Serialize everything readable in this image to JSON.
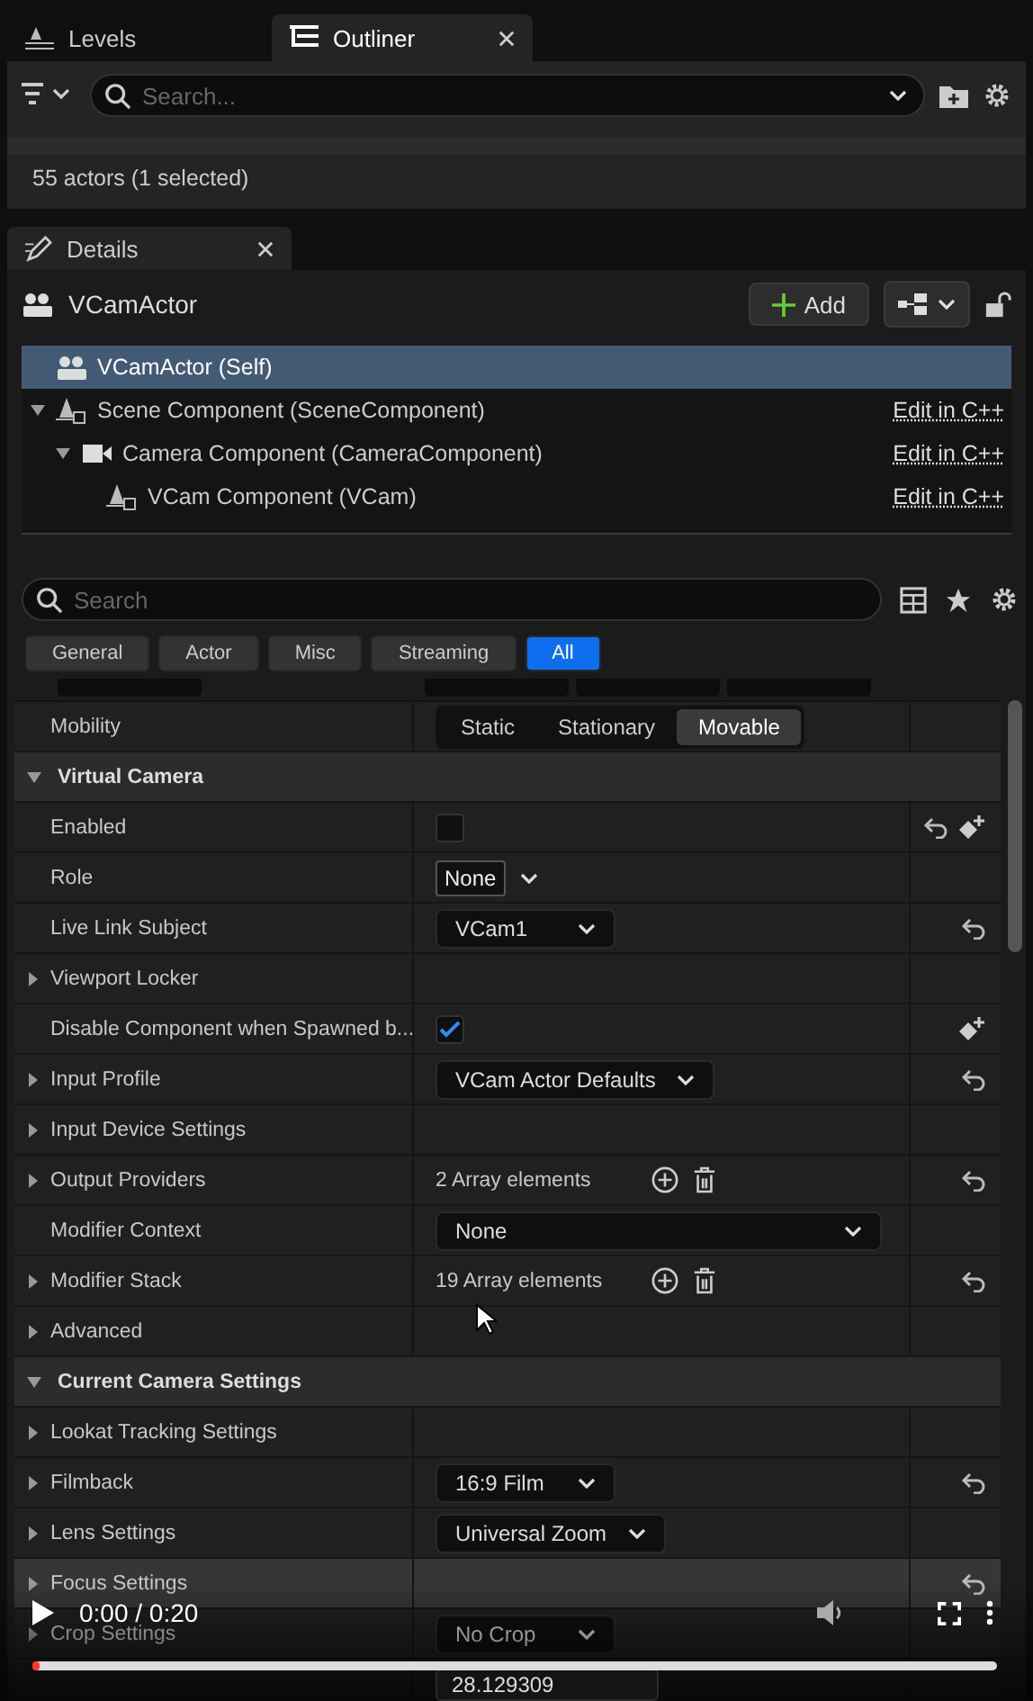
{
  "top_tabs": [
    {
      "label": "Levels",
      "kind": "levels",
      "selected": false,
      "closable": false
    },
    {
      "label": "Outliner",
      "kind": "outliner",
      "selected": true,
      "closable": true
    }
  ],
  "outliner": {
    "search": {
      "placeholder": "Search..."
    },
    "status": "55 actors (1 selected)"
  },
  "details_tab": {
    "label": "Details",
    "closable": true
  },
  "actor": {
    "name": "VCamActor",
    "add_button": "Add"
  },
  "components": [
    {
      "label": "VCamActor (Self)",
      "kind": "actor",
      "selected": true
    },
    {
      "label": "Scene Component (SceneComponent)",
      "kind": "scene",
      "selected": false,
      "expanded": true,
      "link": "Edit in C++",
      "children": [
        {
          "label": "Camera Component (CameraComponent)",
          "kind": "camera",
          "selected": false,
          "expanded": true,
          "link": "Edit in C++",
          "children": [
            {
              "label": "VCam Component (VCam)",
              "kind": "scene",
              "selected": false,
              "link": "Edit in C++"
            }
          ]
        }
      ]
    }
  ],
  "details_search": {
    "placeholder": "Search"
  },
  "filters": [
    {
      "label": "General",
      "selected": false
    },
    {
      "label": "Actor",
      "selected": false
    },
    {
      "label": "Misc",
      "selected": false
    },
    {
      "label": "Streaming",
      "selected": false
    },
    {
      "label": "All",
      "selected": true
    }
  ],
  "rows": [
    {
      "kind": "property",
      "label": "Mobility",
      "value": {
        "kind": "segmented",
        "options": [
          {
            "label": "Static",
            "selected": false
          },
          {
            "label": "Stationary",
            "selected": false
          },
          {
            "label": "Movable",
            "selected": true
          }
        ]
      }
    },
    {
      "kind": "section",
      "label": "Virtual Camera",
      "expanded": true
    },
    {
      "kind": "property",
      "label": "Enabled",
      "value": {
        "kind": "checkbox",
        "checked": false
      },
      "reset": true,
      "keyable": true
    },
    {
      "kind": "property",
      "label": "Role",
      "value": {
        "kind": "tag",
        "text": "None"
      }
    },
    {
      "kind": "property",
      "label": "Live Link Subject",
      "value": {
        "kind": "combo",
        "text": "VCam1"
      },
      "reset": true
    },
    {
      "kind": "property",
      "label": "Viewport Locker",
      "expanded": false
    },
    {
      "kind": "property",
      "label": "Disable Component when Spawned b...",
      "value": {
        "kind": "checkbox",
        "checked": true
      },
      "keyable": true
    },
    {
      "kind": "property",
      "label": "Input Profile",
      "expanded": false,
      "value": {
        "kind": "combo",
        "text": "VCam Actor Defaults"
      },
      "reset": true
    },
    {
      "kind": "property",
      "label": "Input Device Settings",
      "expanded": false
    },
    {
      "kind": "property",
      "label": "Output Providers",
      "expanded": false,
      "value": {
        "kind": "array",
        "text": "2 Array elements"
      },
      "reset": true
    },
    {
      "kind": "property",
      "label": "Modifier Context",
      "value": {
        "kind": "picker",
        "text": "None"
      }
    },
    {
      "kind": "property",
      "label": "Modifier Stack",
      "expanded": false,
      "value": {
        "kind": "array",
        "text": "19 Array elements"
      },
      "reset": true
    },
    {
      "kind": "property",
      "label": "Advanced",
      "expanded": false
    },
    {
      "kind": "section",
      "label": "Current Camera Settings",
      "expanded": true
    },
    {
      "kind": "property",
      "label": "Lookat Tracking Settings",
      "expanded": false
    },
    {
      "kind": "property",
      "label": "Filmback",
      "expanded": false,
      "value": {
        "kind": "combo",
        "text": "16:9 Film"
      },
      "reset": true
    },
    {
      "kind": "property",
      "label": "Lens Settings",
      "expanded": false,
      "value": {
        "kind": "combo",
        "text": "Universal Zoom"
      }
    },
    {
      "kind": "property",
      "label": "Focus Settings",
      "expanded": false,
      "highlighted": true,
      "reset": true
    },
    {
      "kind": "property",
      "label": "Crop Settings",
      "expanded": false,
      "value": {
        "kind": "combo",
        "text": "No Crop"
      }
    },
    {
      "kind": "property",
      "value": {
        "kind": "number",
        "text": "28.129309"
      }
    }
  ],
  "video": {
    "time": "0:00 / 0:20",
    "progress": {
      "level": 0
    }
  }
}
